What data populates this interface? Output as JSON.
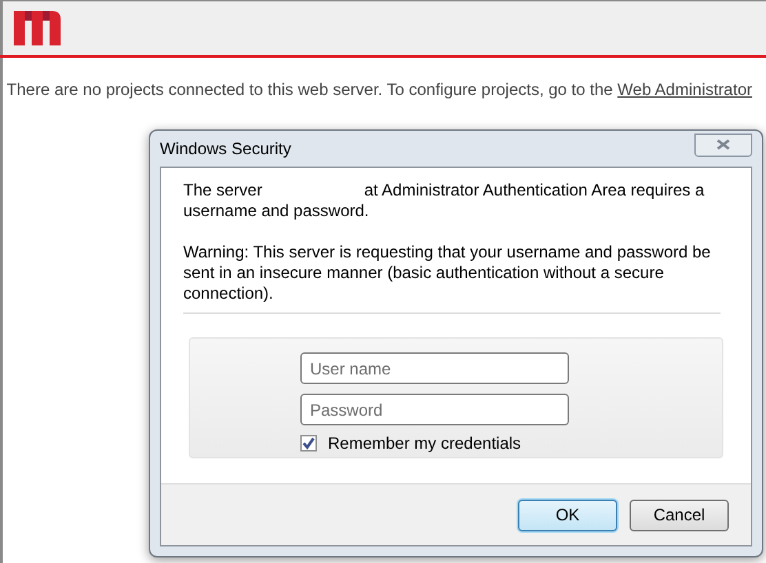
{
  "page": {
    "notice": "There are no projects connected to this web server. To configure projects, go to the",
    "notice_link": "Web Administrator"
  },
  "dialog": {
    "title": "Windows Security",
    "server_prefix": "The server",
    "server_suffix": "at Administrator Authentication Area requires a username and password.",
    "warning": "Warning: This server is requesting that your username and password be sent in an insecure manner (basic authentication without a secure connection).",
    "fields": [
      {
        "placeholder": "User name"
      },
      {
        "placeholder": "Password"
      }
    ],
    "remember": {
      "label": "Remember my credentials",
      "checked": true
    },
    "buttons": [
      {
        "label": "OK",
        "default": true
      },
      {
        "label": "Cancel",
        "default": false
      }
    ]
  }
}
